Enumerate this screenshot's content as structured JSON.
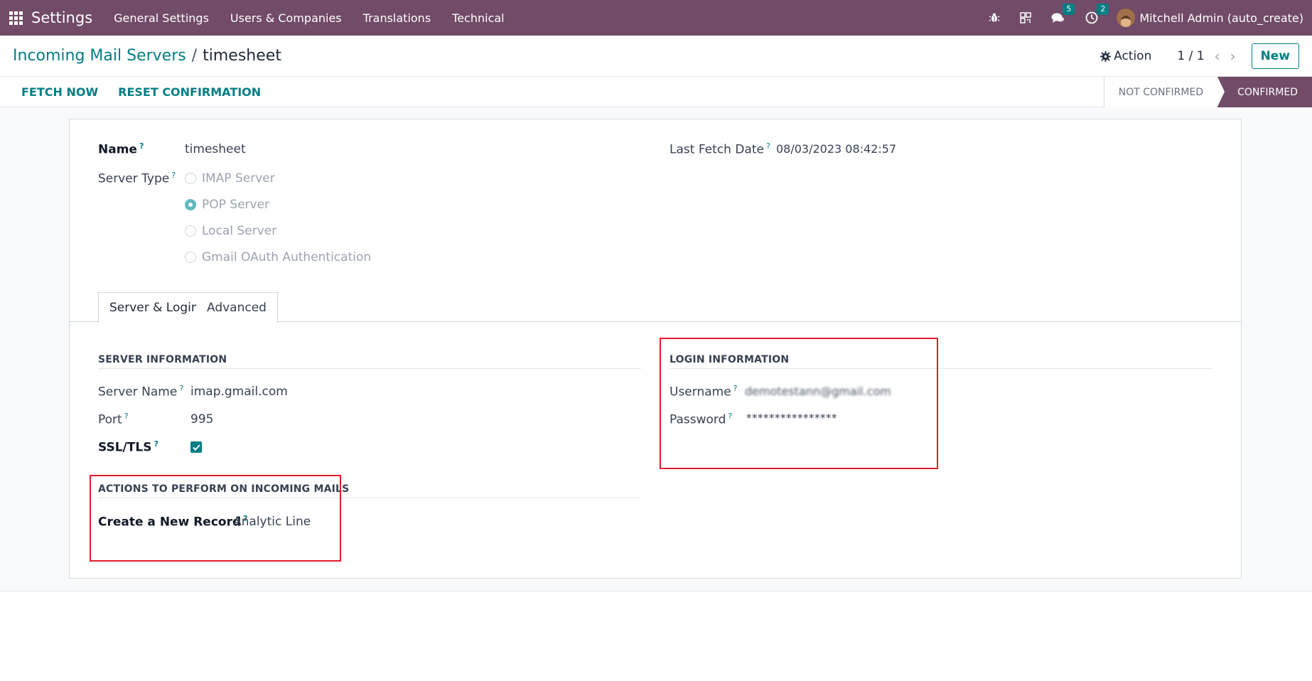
{
  "navbar": {
    "app_name": "Settings",
    "menu": [
      "General Settings",
      "Users & Companies",
      "Translations",
      "Technical"
    ],
    "messages_count": "5",
    "activities_count": "2",
    "user_name": "Mitchell Admin (auto_create)"
  },
  "control_panel": {
    "breadcrumb_parent": "Incoming Mail Servers",
    "breadcrumb_sep": "/",
    "breadcrumb_current": "timesheet",
    "action_label": "Action",
    "pager": "1 / 1",
    "new_label": "New"
  },
  "statusbar": {
    "fetch_now": "FETCH NOW",
    "reset_confirmation": "RESET CONFIRMATION",
    "stages": [
      "NOT CONFIRMED",
      "CONFIRMED"
    ],
    "active_stage": "CONFIRMED"
  },
  "form": {
    "name_label": "Name",
    "name_value": "timesheet",
    "server_type_label": "Server Type",
    "server_types": [
      "IMAP Server",
      "POP Server",
      "Local Server",
      "Gmail OAuth Authentication"
    ],
    "selected_server_type": "POP Server",
    "last_fetch_label": "Last Fetch Date",
    "last_fetch_value": "08/03/2023 08:42:57",
    "tabs": [
      "Server & Login",
      "Advanced"
    ],
    "server_info_title": "SERVER INFORMATION",
    "server_name_label": "Server Name",
    "server_name_value": "imap.gmail.com",
    "port_label": "Port",
    "port_value": "995",
    "ssl_label": "SSL/TLS",
    "ssl_checked": true,
    "login_info_title": "LOGIN INFORMATION",
    "username_label": "Username",
    "username_value": "demotestann@gmail.com",
    "password_label": "Password",
    "password_value": "****************",
    "actions_title": "ACTIONS TO PERFORM ON INCOMING MAILS",
    "create_record_label": "Create a New Record",
    "create_record_value": "Analytic Line",
    "help_mark": "?"
  },
  "colors": {
    "brand": "#714b67",
    "accent": "#017e84",
    "highlight_box": "#e11d2b"
  }
}
